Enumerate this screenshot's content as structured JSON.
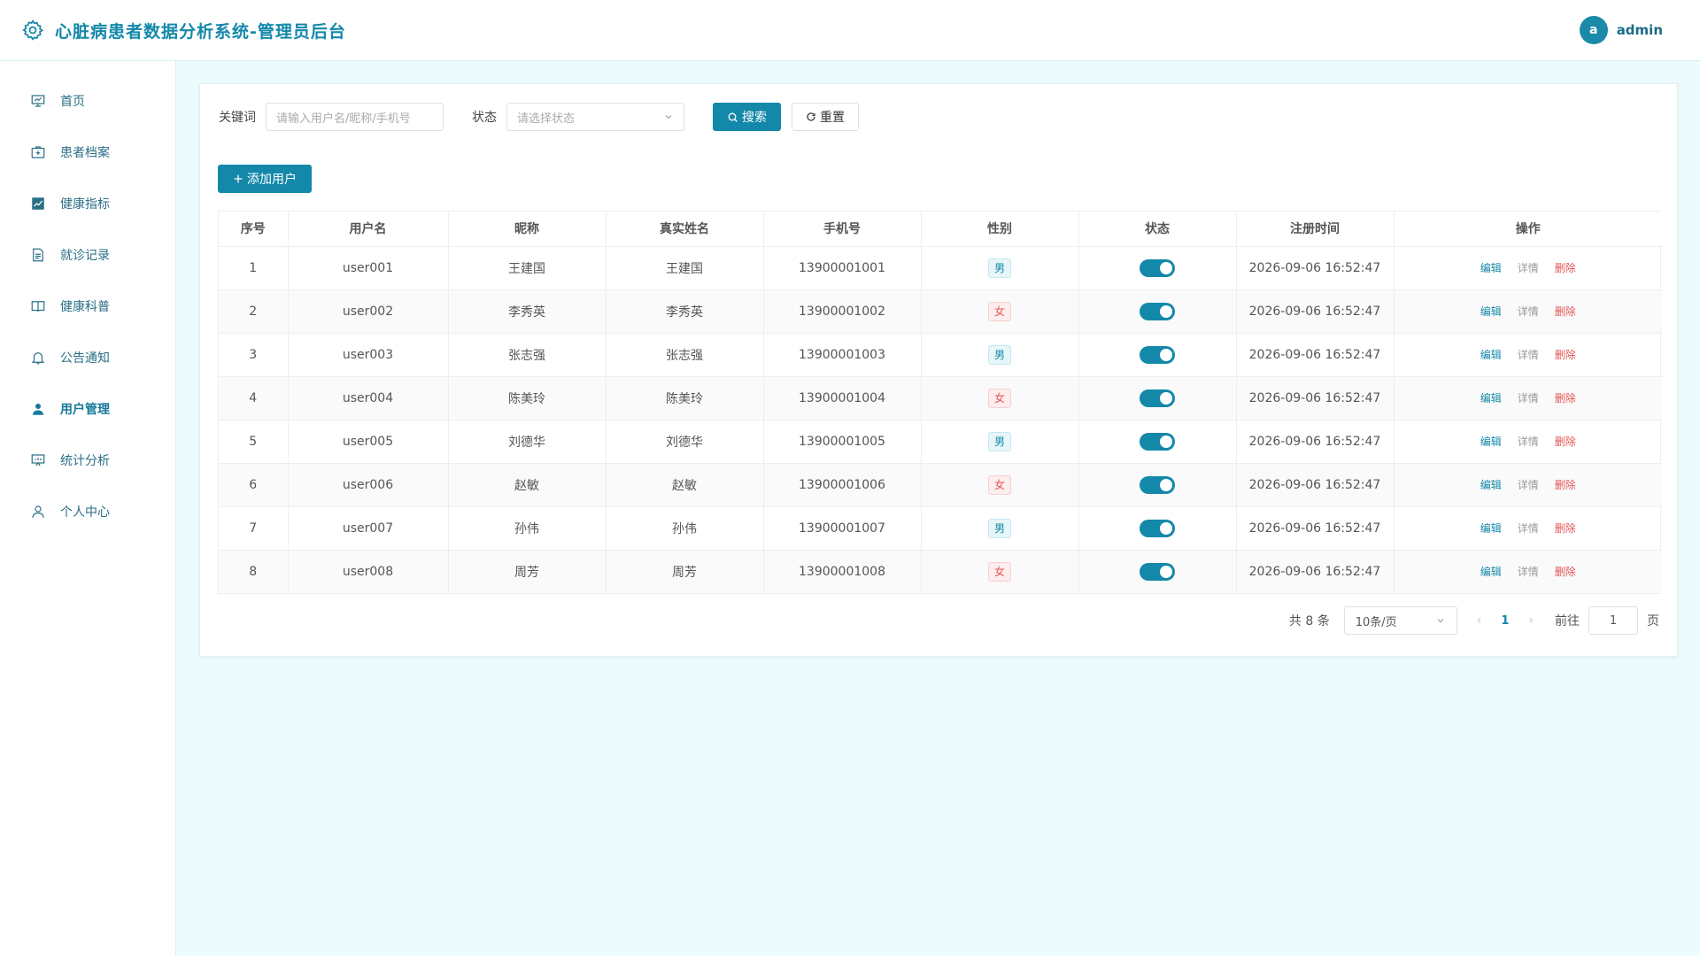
{
  "header": {
    "title": "心脏病患者数据分析系统-管理员后台",
    "avatar_letter": "a",
    "username": "admin"
  },
  "sidebar": {
    "items": [
      {
        "label": "首页",
        "icon": "dashboard-icon"
      },
      {
        "label": "患者档案",
        "icon": "medical-kit-icon"
      },
      {
        "label": "健康指标",
        "icon": "trend-chart-icon"
      },
      {
        "label": "就诊记录",
        "icon": "document-icon"
      },
      {
        "label": "健康科普",
        "icon": "book-icon"
      },
      {
        "label": "公告通知",
        "icon": "bell-icon"
      },
      {
        "label": "用户管理",
        "icon": "user-filled-icon",
        "active": true
      },
      {
        "label": "统计分析",
        "icon": "presentation-chart-icon"
      },
      {
        "label": "个人中心",
        "icon": "user-outline-icon"
      }
    ]
  },
  "search": {
    "keyword_label": "关键词",
    "keyword_placeholder": "请输入用户名/昵称/手机号",
    "status_label": "状态",
    "status_placeholder": "请选择状态",
    "search_button": "搜索",
    "reset_button": "重置"
  },
  "add_button": "添加用户",
  "table": {
    "columns": [
      "序号",
      "用户名",
      "昵称",
      "真实姓名",
      "手机号",
      "性别",
      "状态",
      "注册时间",
      "操作"
    ],
    "rows": [
      {
        "index": "1",
        "username": "user001",
        "nickname": "王建国",
        "real_name": "王建国",
        "phone": "13900001001",
        "gender": "男",
        "status_on": true,
        "registered": "2026-09-06 16:52:47"
      },
      {
        "index": "2",
        "username": "user002",
        "nickname": "李秀英",
        "real_name": "李秀英",
        "phone": "13900001002",
        "gender": "女",
        "status_on": true,
        "registered": "2026-09-06 16:52:47"
      },
      {
        "index": "3",
        "username": "user003",
        "nickname": "张志强",
        "real_name": "张志强",
        "phone": "13900001003",
        "gender": "男",
        "status_on": true,
        "registered": "2026-09-06 16:52:47"
      },
      {
        "index": "4",
        "username": "user004",
        "nickname": "陈美玲",
        "real_name": "陈美玲",
        "phone": "13900001004",
        "gender": "女",
        "status_on": true,
        "registered": "2026-09-06 16:52:47"
      },
      {
        "index": "5",
        "username": "user005",
        "nickname": "刘德华",
        "real_name": "刘德华",
        "phone": "13900001005",
        "gender": "男",
        "status_on": true,
        "registered": "2026-09-06 16:52:47"
      },
      {
        "index": "6",
        "username": "user006",
        "nickname": "赵敏",
        "real_name": "赵敏",
        "phone": "13900001006",
        "gender": "女",
        "status_on": true,
        "registered": "2026-09-06 16:52:47"
      },
      {
        "index": "7",
        "username": "user007",
        "nickname": "孙伟",
        "real_name": "孙伟",
        "phone": "13900001007",
        "gender": "男",
        "status_on": true,
        "registered": "2026-09-06 16:52:47"
      },
      {
        "index": "8",
        "username": "user008",
        "nickname": "周芳",
        "real_name": "周芳",
        "phone": "13900001008",
        "gender": "女",
        "status_on": true,
        "registered": "2026-09-06 16:52:47"
      }
    ],
    "actions": {
      "edit": "编辑",
      "detail": "详情",
      "delete": "删除"
    }
  },
  "pagination": {
    "total_text": "共 8 条",
    "page_size": "10条/页",
    "current_page": "1",
    "goto_label": "前往",
    "goto_value": "1",
    "page_suffix": "页"
  },
  "colors": {
    "primary": "#1488a9",
    "danger": "#e45656",
    "background": "#ecfbfd"
  }
}
